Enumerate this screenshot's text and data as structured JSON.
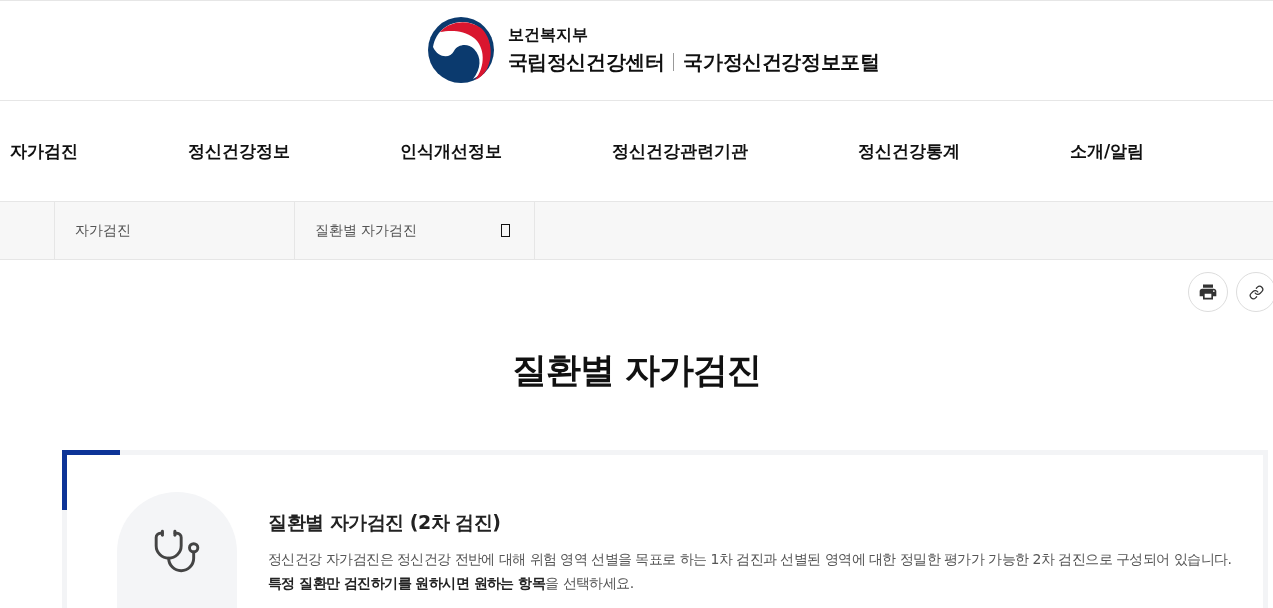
{
  "header": {
    "agency": "보건복지부",
    "center": "국립정신건강센터",
    "portal": "국가정신건강정보포털"
  },
  "nav": [
    "자가검진",
    "정신건강정보",
    "인식개선정보",
    "정신건강관련기관",
    "정신건강통계",
    "소개/알림"
  ],
  "breadcrumb": [
    {
      "label": "자가검진",
      "menu_icon": false
    },
    {
      "label": "질환별 자가검진",
      "menu_icon": true
    }
  ],
  "page_title": "질환별 자가검진",
  "intro": {
    "title": "질환별 자가검진 (2차 검진)",
    "lines": [
      "정신건강 자가검진은 정신건강 전반에 대해 위험 영역 선별을 목표로 하는 1차 검진과 선별된 영역에 대한 정밀한 평가가 가능한 2차 검진으로 구성되어 있습니다.",
      "**특정 질환만 검진하기를 원하시면 원하는 항목**을 선택하세요."
    ]
  }
}
